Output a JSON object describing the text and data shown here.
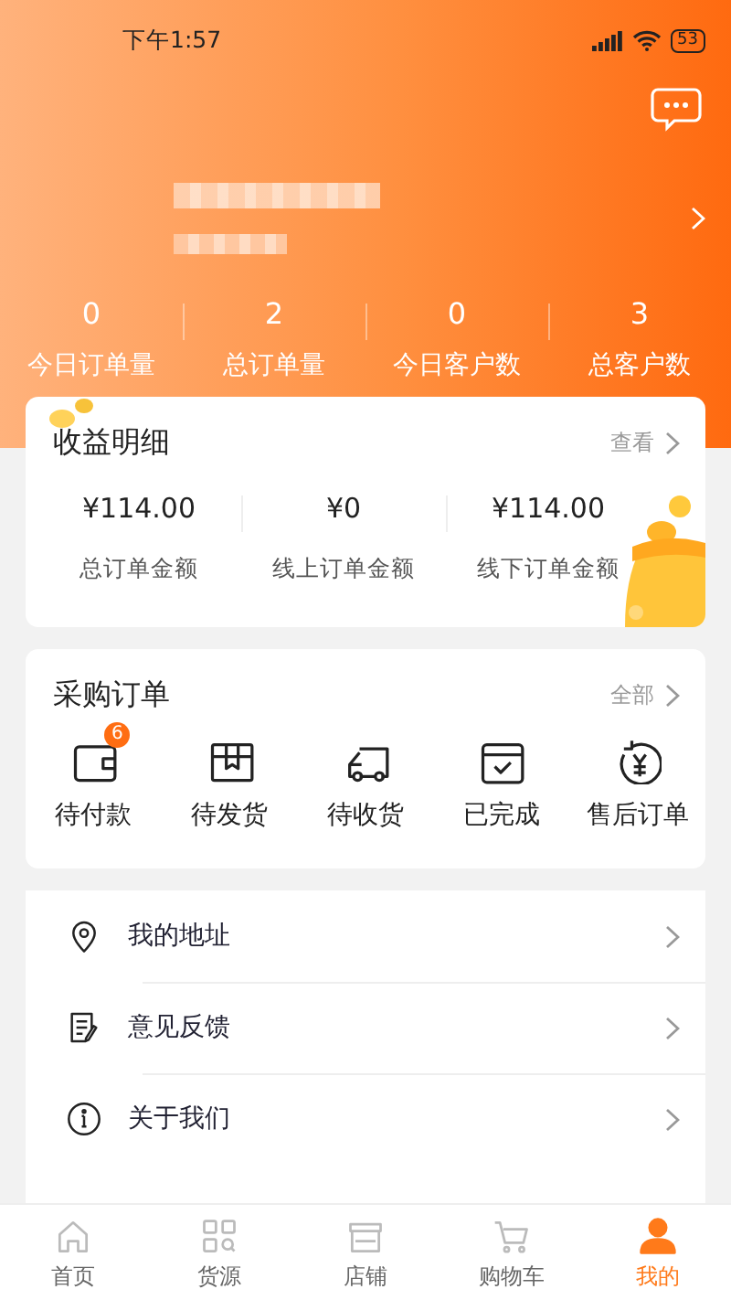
{
  "status_bar": {
    "time": "下午1:57",
    "battery": "53"
  },
  "stats": [
    {
      "value": "0",
      "label": "今日订单量"
    },
    {
      "value": "2",
      "label": "总订单量"
    },
    {
      "value": "0",
      "label": "今日客户数"
    },
    {
      "value": "3",
      "label": "总客户数"
    }
  ],
  "income": {
    "title": "收益明细",
    "link": "查看",
    "items": [
      {
        "amount": "¥114.00",
        "label": "总订单金额"
      },
      {
        "amount": "¥0",
        "label": "线上订单金额"
      },
      {
        "amount": "¥114.00",
        "label": "线下订单金额"
      }
    ]
  },
  "orders": {
    "title": "采购订单",
    "link": "全部",
    "items": [
      {
        "kind": "wallet",
        "label": "待付款",
        "badge": "6"
      },
      {
        "kind": "box",
        "label": "待发货"
      },
      {
        "kind": "truck",
        "label": "待收货"
      },
      {
        "kind": "done",
        "label": "已完成"
      },
      {
        "kind": "refund",
        "label": "售后订单"
      }
    ]
  },
  "menu": [
    {
      "kind": "location",
      "label": "我的地址"
    },
    {
      "kind": "note",
      "label": "意见反馈"
    },
    {
      "kind": "info",
      "label": "关于我们"
    }
  ],
  "tabs": [
    {
      "kind": "home",
      "label": "首页",
      "selected": false
    },
    {
      "kind": "grid",
      "label": "货源",
      "selected": false
    },
    {
      "kind": "shop",
      "label": "店铺",
      "selected": false
    },
    {
      "kind": "cart",
      "label": "购物车",
      "selected": false
    },
    {
      "kind": "user",
      "label": "我的",
      "selected": true
    }
  ]
}
